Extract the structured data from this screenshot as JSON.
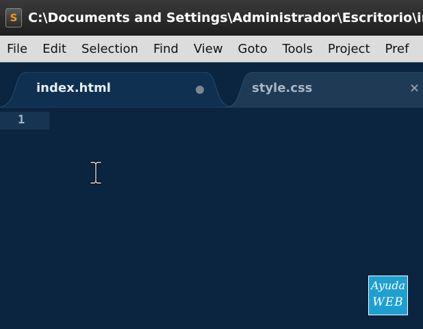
{
  "window": {
    "title": "C:\\Documents and Settings\\Administrador\\Escritorio\\ind",
    "app_icon_letter": "S"
  },
  "menu": {
    "items": [
      "File",
      "Edit",
      "Selection",
      "Find",
      "View",
      "Goto",
      "Tools",
      "Project",
      "Pref"
    ]
  },
  "tabs": [
    {
      "label": "index.html",
      "state": "active",
      "modified": true
    },
    {
      "label": "style.css",
      "state": "inactive",
      "close_glyph": "×"
    }
  ],
  "editor": {
    "line_numbers": [
      "1"
    ]
  },
  "watermark": {
    "line1": "Ayuda",
    "line2": "WEB"
  },
  "colors": {
    "editor_background": "#0b2440",
    "titlebar": "#262626",
    "menubar": "#dcdcdc",
    "active_tab": "#103052",
    "inactive_tab": "#1f3a55",
    "badge": "#1e9fd1"
  }
}
